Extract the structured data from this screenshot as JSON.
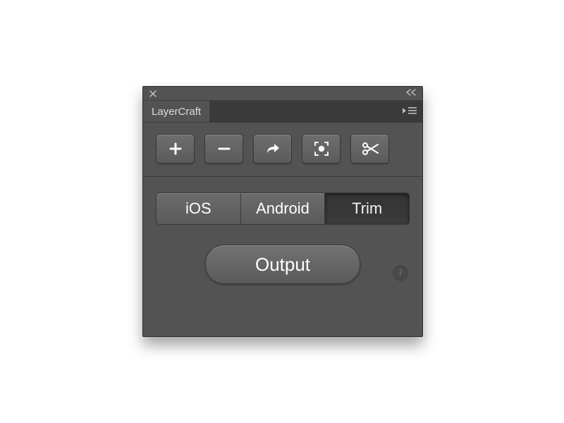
{
  "panel": {
    "title": "LayerCraft"
  },
  "toolbar": {
    "buttons": [
      {
        "icon": "plus-icon"
      },
      {
        "icon": "minus-icon"
      },
      {
        "icon": "share-icon"
      },
      {
        "icon": "target-icon"
      },
      {
        "icon": "scissors-icon"
      }
    ]
  },
  "segments": [
    {
      "label": "iOS",
      "active": true
    },
    {
      "label": "Android",
      "active": true
    },
    {
      "label": "Trim",
      "active": false
    }
  ],
  "output": {
    "label": "Output"
  },
  "info": {
    "glyph": "i"
  },
  "icons": {
    "close": "close",
    "collapse": "collapse",
    "flyout": "flyout",
    "info": "info"
  }
}
